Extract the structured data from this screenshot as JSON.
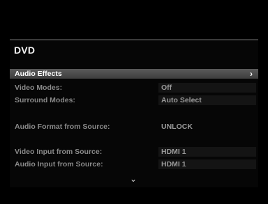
{
  "page": {
    "title": "DVD"
  },
  "menu": {
    "selected": {
      "label": "Audio Effects",
      "arrow": "›"
    },
    "items": [
      {
        "label": "Video Modes:",
        "value": "Off"
      },
      {
        "label": "Surround Modes:",
        "value": "Auto Select"
      },
      {
        "label": "Audio Format from Source:",
        "value": "UNLOCK"
      },
      {
        "label": "Video Input from Source:",
        "value": "HDMI 1"
      },
      {
        "label": "Audio Input from Source:",
        "value": "HDMI 1"
      }
    ]
  },
  "footer": {
    "scroll_indicator": "⌄"
  },
  "icons": {
    "next": "chevron-right-icon",
    "scroll": "chevron-down-icon"
  }
}
